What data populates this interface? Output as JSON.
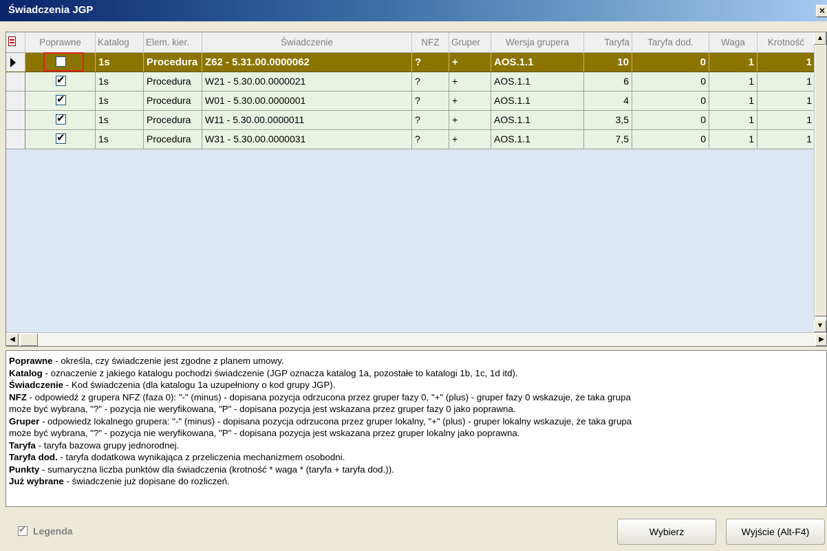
{
  "window": {
    "title": "Świadczenia JGP",
    "close_glyph": "×"
  },
  "grid": {
    "columns": [
      {
        "label": ""
      },
      {
        "label": "Poprawne"
      },
      {
        "label": "Katalog"
      },
      {
        "label": "Elem. kier."
      },
      {
        "label": "Świadczenie"
      },
      {
        "label": "NFZ"
      },
      {
        "label": "Gruper"
      },
      {
        "label": "Wersja grupera"
      },
      {
        "label": "Taryfa"
      },
      {
        "label": "Taryfa dod."
      },
      {
        "label": "Waga"
      },
      {
        "label": "Krotność"
      }
    ],
    "rows": [
      {
        "poprawne": false,
        "katalog": "1s",
        "elem": "Procedura",
        "swiadczenie": "Z62 - 5.31.00.0000062",
        "nfz": "?",
        "gruper": "+",
        "wersja": "AOS.1.1",
        "taryfa": "10",
        "taryfa_dod": "0",
        "waga": "1",
        "krotnosc": "1",
        "selected": true
      },
      {
        "poprawne": true,
        "katalog": "1s",
        "elem": "Procedura",
        "swiadczenie": "W21 - 5.30.00.0000021",
        "nfz": "?",
        "gruper": "+",
        "wersja": "AOS.1.1",
        "taryfa": "6",
        "taryfa_dod": "0",
        "waga": "1",
        "krotnosc": "1"
      },
      {
        "poprawne": true,
        "katalog": "1s",
        "elem": "Procedura",
        "swiadczenie": "W01 - 5.30.00.0000001",
        "nfz": "?",
        "gruper": "+",
        "wersja": "AOS.1.1",
        "taryfa": "4",
        "taryfa_dod": "0",
        "waga": "1",
        "krotnosc": "1"
      },
      {
        "poprawne": true,
        "katalog": "1s",
        "elem": "Procedura",
        "swiadczenie": "W11 - 5.30.00.0000011",
        "nfz": "?",
        "gruper": "+",
        "wersja": "AOS.1.1",
        "taryfa": "3,5",
        "taryfa_dod": "0",
        "waga": "1",
        "krotnosc": "1"
      },
      {
        "poprawne": true,
        "katalog": "1s",
        "elem": "Procedura",
        "swiadczenie": "W31 - 5.30.00.0000031",
        "nfz": "?",
        "gruper": "+",
        "wersja": "AOS.1.1",
        "taryfa": "7,5",
        "taryfa_dod": "0",
        "waga": "1",
        "krotnosc": "1"
      }
    ]
  },
  "legend": {
    "lines": [
      {
        "bold": "Poprawne",
        "text": " - określa, czy świadczenie jest zgodne z planem umowy."
      },
      {
        "bold": "Katalog",
        "text": " - oznaczenie z jakiego katalogu pochodzi świadczenie (JGP oznacza katalog 1a, pozostałe to katalogi 1b, 1c, 1d itd)."
      },
      {
        "bold": "Świadczenie",
        "text": " - Kod świadczenia (dla katalogu 1a uzupełniony o kod grupy JGP)."
      },
      {
        "bold": "NFZ",
        "text": " - odpowiedź z grupera NFZ (faza 0):  \"-\" (minus) - dopisana pozycja odrzucona przez gruper  fazy 0,  \"+\" (plus) - gruper fazy 0 wskazuje, że taka grupa"
      },
      {
        "bold": "",
        "text": "może być wybrana, \"?\" - pozycja nie weryfikowana, \"P\" - dopisana pozycja jest wskazana przez gruper fazy 0 jako poprawna."
      },
      {
        "bold": "Gruper",
        "text": " - odpowiedz lokalnego grupera: \"-\" (minus) - dopisana pozycja odrzucona przez gruper lokalny, \"+\" (plus) - gruper lokalny wskazuje, że taka grupa"
      },
      {
        "bold": "",
        "text": "może być wybrana,  \"?\" - pozycja nie weryfikowana,  \"P\" - dopisana pozycja jest wskazana przez gruper lokalny jako poprawna."
      },
      {
        "bold": "Taryfa",
        "text": " - taryfa bazowa grupy jednorodnej."
      },
      {
        "bold": "Taryfa dod.",
        "text": " - taryfa dodatkowa wynikająca z przeliczenia mechanizmem osobodni."
      },
      {
        "bold": "Punkty",
        "text": " - sumaryczna liczba punktów dla świadczenia (krotność * waga * (taryfa + taryfa dod.))."
      },
      {
        "bold": "Już wybrane",
        "text": " - świadczenie już dopisane do rozliczeń."
      }
    ]
  },
  "footer": {
    "legend_checkbox_label": "Legenda",
    "legend_checked": true,
    "select_button": "Wybierz",
    "exit_button": "Wyjście (Alt-F4)"
  }
}
